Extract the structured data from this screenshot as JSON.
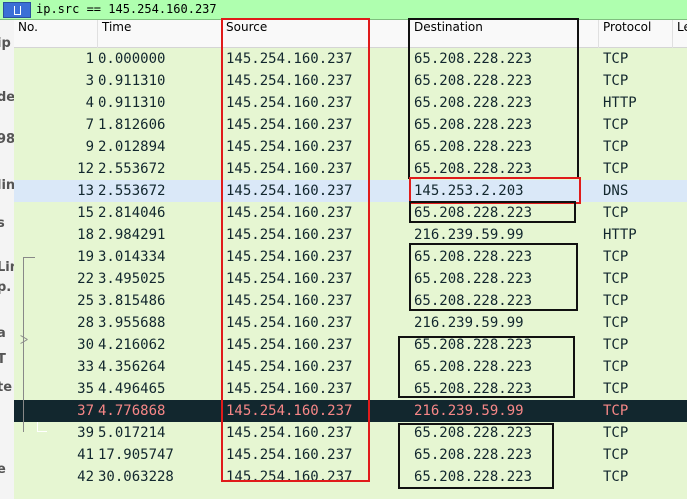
{
  "filter": {
    "text": "ip.src == 145.254.160.237"
  },
  "background_fragments": [
    "ip",
    "de",
    "98",
    "lin",
    "s",
    "Lin",
    "p.",
    "a",
    "T",
    "te",
    "e"
  ],
  "columns": [
    "No.",
    "Time",
    "Source",
    "Destination",
    "Protocol",
    "Le"
  ],
  "packets": [
    {
      "no": "1",
      "time": "0.000000",
      "source": "145.254.160.237",
      "destination": "65.208.228.223",
      "protocol": "TCP"
    },
    {
      "no": "3",
      "time": "0.911310",
      "source": "145.254.160.237",
      "destination": "65.208.228.223",
      "protocol": "TCP"
    },
    {
      "no": "4",
      "time": "0.911310",
      "source": "145.254.160.237",
      "destination": "65.208.228.223",
      "protocol": "HTTP"
    },
    {
      "no": "7",
      "time": "1.812606",
      "source": "145.254.160.237",
      "destination": "65.208.228.223",
      "protocol": "TCP"
    },
    {
      "no": "9",
      "time": "2.012894",
      "source": "145.254.160.237",
      "destination": "65.208.228.223",
      "protocol": "TCP"
    },
    {
      "no": "12",
      "time": "2.553672",
      "source": "145.254.160.237",
      "destination": "65.208.228.223",
      "protocol": "TCP"
    },
    {
      "no": "13",
      "time": "2.553672",
      "source": "145.254.160.237",
      "destination": "145.253.2.203",
      "protocol": "DNS"
    },
    {
      "no": "15",
      "time": "2.814046",
      "source": "145.254.160.237",
      "destination": "65.208.228.223",
      "protocol": "TCP"
    },
    {
      "no": "18",
      "time": "2.984291",
      "source": "145.254.160.237",
      "destination": "216.239.59.99",
      "protocol": "HTTP"
    },
    {
      "no": "19",
      "time": "3.014334",
      "source": "145.254.160.237",
      "destination": "65.208.228.223",
      "protocol": "TCP"
    },
    {
      "no": "22",
      "time": "3.495025",
      "source": "145.254.160.237",
      "destination": "65.208.228.223",
      "protocol": "TCP"
    },
    {
      "no": "25",
      "time": "3.815486",
      "source": "145.254.160.237",
      "destination": "65.208.228.223",
      "protocol": "TCP"
    },
    {
      "no": "28",
      "time": "3.955688",
      "source": "145.254.160.237",
      "destination": "216.239.59.99",
      "protocol": "TCP"
    },
    {
      "no": "30",
      "time": "4.216062",
      "source": "145.254.160.237",
      "destination": "65.208.228.223",
      "protocol": "TCP"
    },
    {
      "no": "33",
      "time": "4.356264",
      "source": "145.254.160.237",
      "destination": "65.208.228.223",
      "protocol": "TCP"
    },
    {
      "no": "35",
      "time": "4.496465",
      "source": "145.254.160.237",
      "destination": "65.208.228.223",
      "protocol": "TCP"
    },
    {
      "no": "37",
      "time": "4.776868",
      "source": "145.254.160.237",
      "destination": "216.239.59.99",
      "protocol": "TCP"
    },
    {
      "no": "39",
      "time": "5.017214",
      "source": "145.254.160.237",
      "destination": "65.208.228.223",
      "protocol": "TCP"
    },
    {
      "no": "41",
      "time": "17.905747",
      "source": "145.254.160.237",
      "destination": "65.208.228.223",
      "protocol": "TCP"
    },
    {
      "no": "42",
      "time": "30.063228",
      "source": "145.254.160.237",
      "destination": "65.208.228.223",
      "protocol": "TCP"
    }
  ],
  "colors": {
    "filter_valid": "#afffaf",
    "row_tcp": "#e6f6d2",
    "row_dns": "#dae8f8",
    "row_selected_bg": "#12272e",
    "row_selected_fg": "#f78787",
    "annotation_red": "#e01b1b",
    "annotation_black": "#111111"
  }
}
